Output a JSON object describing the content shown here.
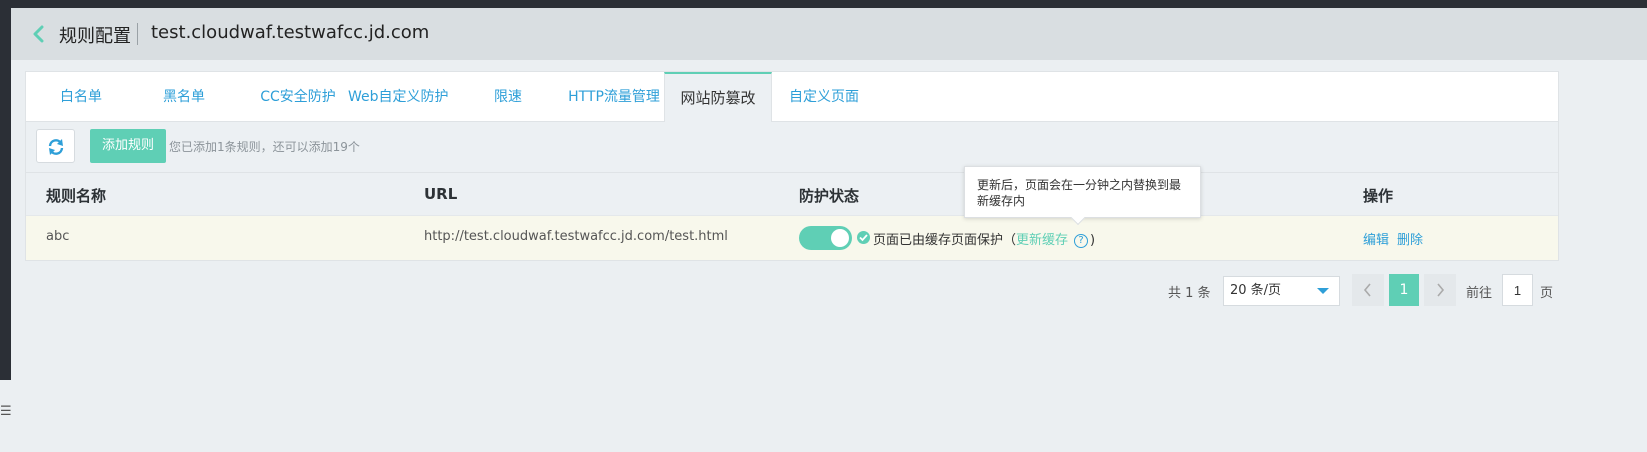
{
  "header": {
    "title": "规则配置",
    "domain": "test.cloudwaf.testwafcc.jd.com"
  },
  "tabs": [
    {
      "label": "白名单",
      "active": false
    },
    {
      "label": "黑名单",
      "active": false
    },
    {
      "label": "CC安全防护",
      "active": false
    },
    {
      "label": "Web自定义防护",
      "active": false
    },
    {
      "label": "限速",
      "active": false
    },
    {
      "label": "HTTP流量管理",
      "active": false
    },
    {
      "label": "网站防篡改",
      "active": true
    },
    {
      "label": "自定义页面",
      "active": false
    }
  ],
  "toolbar": {
    "add_label": "添加规则",
    "hint": "您已添加1条规则，还可以添加19个"
  },
  "table": {
    "columns": [
      "规则名称",
      "URL",
      "防护状态",
      "操作"
    ],
    "rows": [
      {
        "name": "abc",
        "url": "http://test.cloudwaf.testwafcc.jd.com/test.html",
        "enabled": true,
        "status_text": "页面已由缓存页面保护（",
        "update_link": "更新缓存",
        "status_close": ")",
        "edit": "编辑",
        "delete": "删除"
      }
    ]
  },
  "tooltip": {
    "text": "更新后，页面会在一分钟之内替换到最新缓存内"
  },
  "pagination": {
    "total": "共 1 条",
    "page_size": "20 条/页",
    "current_page": "1",
    "goto_label": "前往",
    "goto_value": "1",
    "page_suffix": "页"
  },
  "colors": {
    "accent": "#5fcfb5",
    "link": "#2e9fd8",
    "row_highlight": "#f8f8ec"
  },
  "icons": {
    "back": "chevron-left-icon",
    "refresh": "refresh-icon",
    "check": "check-circle-icon",
    "help": "question-circle-icon"
  }
}
